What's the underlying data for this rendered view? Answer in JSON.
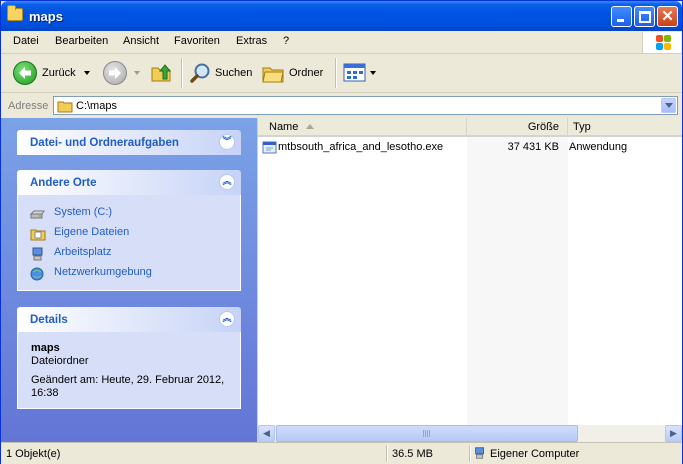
{
  "window": {
    "title": "maps"
  },
  "menu": [
    "Datei",
    "Bearbeiten",
    "Ansicht",
    "Favoriten",
    "Extras",
    "?"
  ],
  "toolbar": {
    "back_label": "Zurück",
    "search_label": "Suchen",
    "folders_label": "Ordner"
  },
  "address": {
    "label": "Adresse",
    "path": "C:\\maps"
  },
  "left_pane": {
    "tasks_title": "Datei- und Ordneraufgaben",
    "other_places_title": "Andere Orte",
    "other_places": [
      {
        "label": "System (C:)",
        "icon": "drive-icon"
      },
      {
        "label": "Eigene Dateien",
        "icon": "my-documents-icon"
      },
      {
        "label": "Arbeitsplatz",
        "icon": "my-computer-icon"
      },
      {
        "label": "Netzwerkumgebung",
        "icon": "network-icon"
      }
    ],
    "details_title": "Details",
    "details": {
      "name": "maps",
      "type": "Dateiordner",
      "modified_line1": "Geändert am: Heute, 29. Februar 2012,",
      "modified_line2": "16:38"
    }
  },
  "columns": {
    "name": "Name",
    "size": "Größe",
    "type": "Typ"
  },
  "files": [
    {
      "name": "mtbsouth_africa_and_lesotho.exe",
      "size": "37 431 KB",
      "type": "Anwendung"
    }
  ],
  "status": {
    "objects": "1 Objekt(e)",
    "size": "36.5 MB",
    "zone": "Eigener Computer"
  },
  "colors": {
    "title_bar": "#0053e1",
    "left_pane_top": "#7ba2e7",
    "left_pane_bottom": "#6375d6",
    "link": "#215dc6"
  }
}
